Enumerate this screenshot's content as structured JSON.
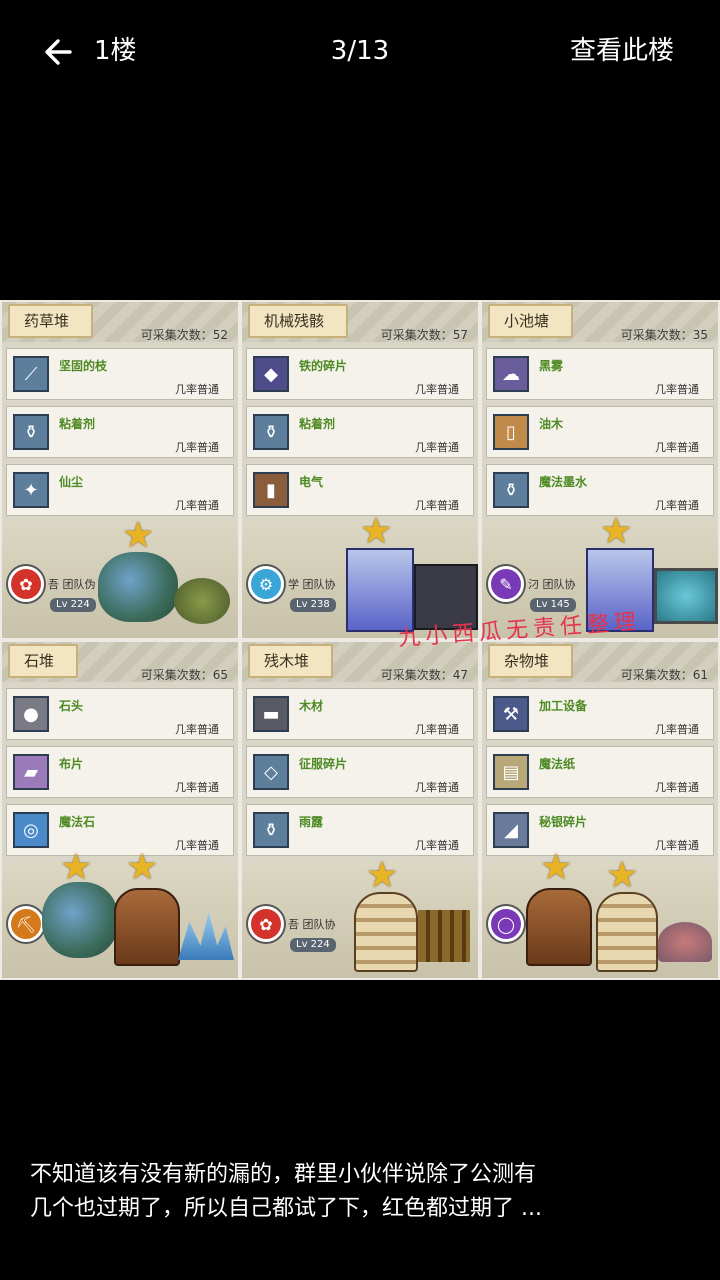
{
  "header": {
    "back_icon": "back-arrow-icon",
    "floor": "1楼",
    "pager": "3/13",
    "view_floor": "查看此楼"
  },
  "shot": {
    "watermark": "九小西瓜无责任整理",
    "panels": [
      {
        "title": "药草堆",
        "count": "可采集次数：52",
        "items": [
          {
            "name": "坚固的枝",
            "rate": "几率普通"
          },
          {
            "name": "粘着剂",
            "rate": "几率普通"
          },
          {
            "name": "仙尘",
            "rate": "几率普通"
          }
        ],
        "meta": "吾 团队伪",
        "lv": "Lv 224"
      },
      {
        "title": "机械残骸",
        "count": "可采集次数：57",
        "items": [
          {
            "name": "铁的碎片",
            "rate": "几率普通"
          },
          {
            "name": "粘着剂",
            "rate": "几率普通"
          },
          {
            "name": "电气",
            "rate": "几率普通"
          }
        ],
        "meta": "学 团队协",
        "lv": "Lv 238"
      },
      {
        "title": "小池塘",
        "count": "可采集次数：35",
        "items": [
          {
            "name": "黑雾",
            "rate": "几率普通"
          },
          {
            "name": "油木",
            "rate": "几率普通"
          },
          {
            "name": "魔法墨水",
            "rate": "几率普通"
          }
        ],
        "meta": "汈 团队协",
        "lv": "Lv 145"
      },
      {
        "title": "石堆",
        "count": "可采集次数：65",
        "items": [
          {
            "name": "石头",
            "rate": "几率普通"
          },
          {
            "name": "布片",
            "rate": "几率普通"
          },
          {
            "name": "魔法石",
            "rate": "几率普通"
          }
        ],
        "meta": "",
        "lv": ""
      },
      {
        "title": "残木堆",
        "count": "可采集次数：47",
        "items": [
          {
            "name": "木材",
            "rate": "几率普通"
          },
          {
            "name": "征服碎片",
            "rate": "几率普通"
          },
          {
            "name": "雨露",
            "rate": "几率普通"
          }
        ],
        "meta": "吾 团队协",
        "lv": "Lv 224"
      },
      {
        "title": "杂物堆",
        "count": "可采集次数：61",
        "items": [
          {
            "name": "加工设备",
            "rate": "几率普通"
          },
          {
            "name": "魔法纸",
            "rate": "几率普通"
          },
          {
            "name": "秘银碎片",
            "rate": "几率普通"
          }
        ],
        "meta": "",
        "lv": ""
      }
    ]
  },
  "caption": {
    "line1": "不知道该有没有新的漏的，群里小伙伴说除了公测有",
    "line2": "几个也过期了，所以自己都试了下，红色都过期了 ..."
  }
}
